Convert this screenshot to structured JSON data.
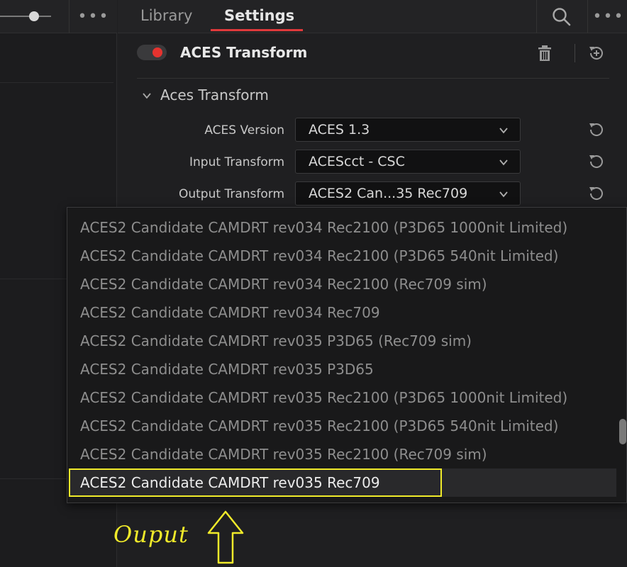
{
  "tabs": {
    "library": "Library",
    "settings": "Settings"
  },
  "node": {
    "title": "ACES Transform"
  },
  "section": {
    "title": "Aces Transform"
  },
  "fields": [
    {
      "label": "ACES Version",
      "value": "ACES 1.3"
    },
    {
      "label": "Input Transform",
      "value": "ACEScct - CSC"
    },
    {
      "label": "Output Transform",
      "value": "ACES2 Can...35 Rec709"
    }
  ],
  "dropdown": {
    "options": [
      "ACES2 Candidate CAMDRT rev034 Rec2100 (P3D65 1000nit Limited)",
      "ACES2 Candidate CAMDRT rev034 Rec2100 (P3D65 540nit Limited)",
      "ACES2 Candidate CAMDRT rev034 Rec2100 (Rec709 sim)",
      "ACES2 Candidate CAMDRT rev034 Rec709",
      "ACES2 Candidate CAMDRT rev035 P3D65 (Rec709 sim)",
      "ACES2 Candidate CAMDRT rev035 P3D65",
      "ACES2 Candidate CAMDRT rev035 Rec2100 (P3D65 1000nit Limited)",
      "ACES2 Candidate CAMDRT rev035 Rec2100 (P3D65 540nit Limited)",
      "ACES2 Candidate CAMDRT rev035 Rec2100 (Rec709 sim)",
      "ACES2 Candidate CAMDRT rev035 Rec709"
    ],
    "selected_index": 9
  },
  "annotation": {
    "text": "Ouput"
  },
  "colors": {
    "accent_red": "#e0393b",
    "highlight_yellow": "#f0ea2a",
    "background": "#1f1f21"
  },
  "icons": {
    "search": "search-icon",
    "more": "more-icon",
    "trash": "trash-icon",
    "reset": "reset-icon",
    "chevron": "chevron-down-icon",
    "arrow": "arrow-up-icon"
  }
}
